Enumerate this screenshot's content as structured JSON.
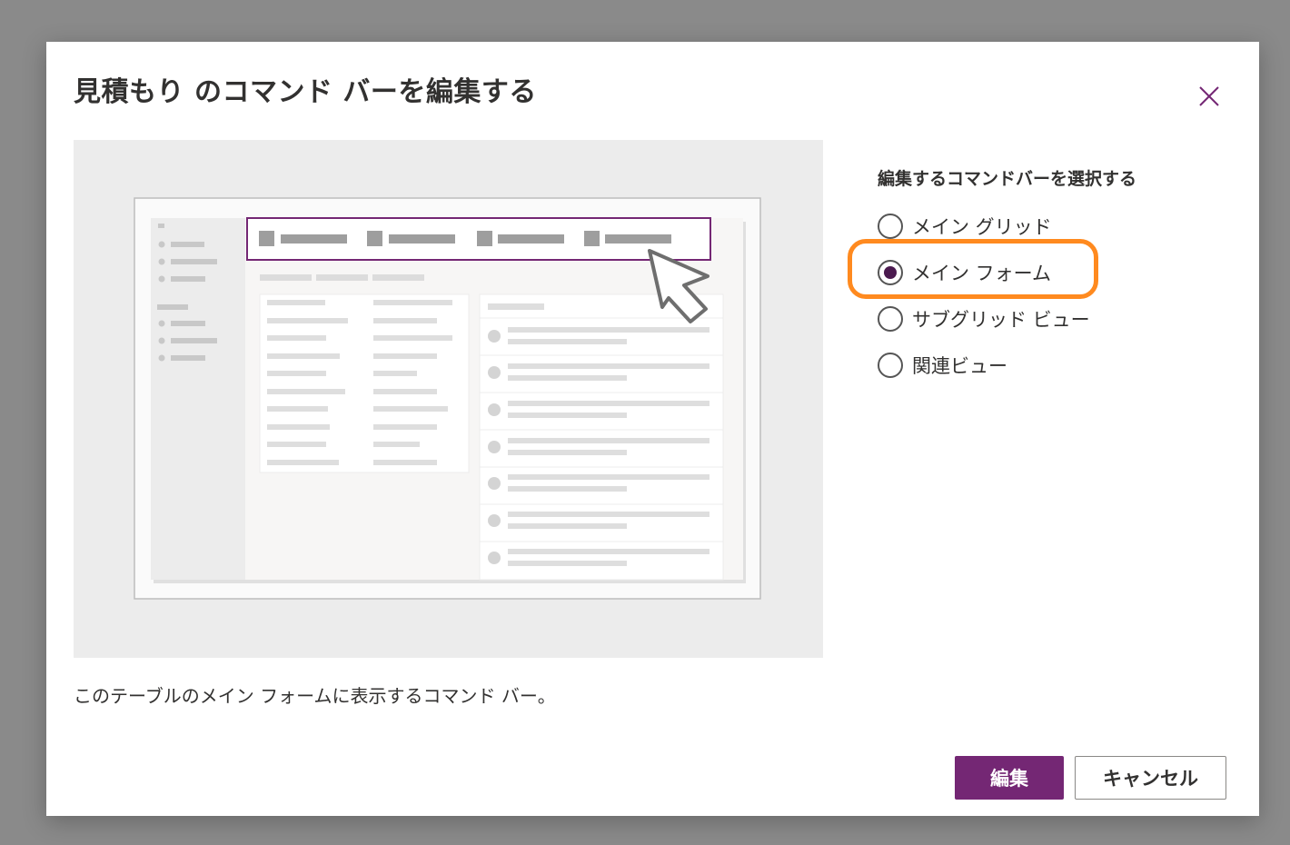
{
  "dialog": {
    "title": "見積もり のコマンド バーを編集する",
    "close_icon": "close-icon",
    "description": "このテーブルのメイン フォームに表示するコマンド バー。"
  },
  "options": {
    "heading": "編集するコマンドバーを選択する",
    "items": [
      {
        "label": "メイン グリッド",
        "selected": false
      },
      {
        "label": "メイン フォーム",
        "selected": true
      },
      {
        "label": "サブグリッド ビュー",
        "selected": false
      },
      {
        "label": "関連ビュー",
        "selected": false
      }
    ]
  },
  "buttons": {
    "primary_label": "編集",
    "secondary_label": "キャンセル"
  },
  "colors": {
    "accent": "#742774",
    "radio_selected": "#4b1a4f",
    "highlight": "#ff8a1f",
    "overlay": "#8a8a8a"
  }
}
